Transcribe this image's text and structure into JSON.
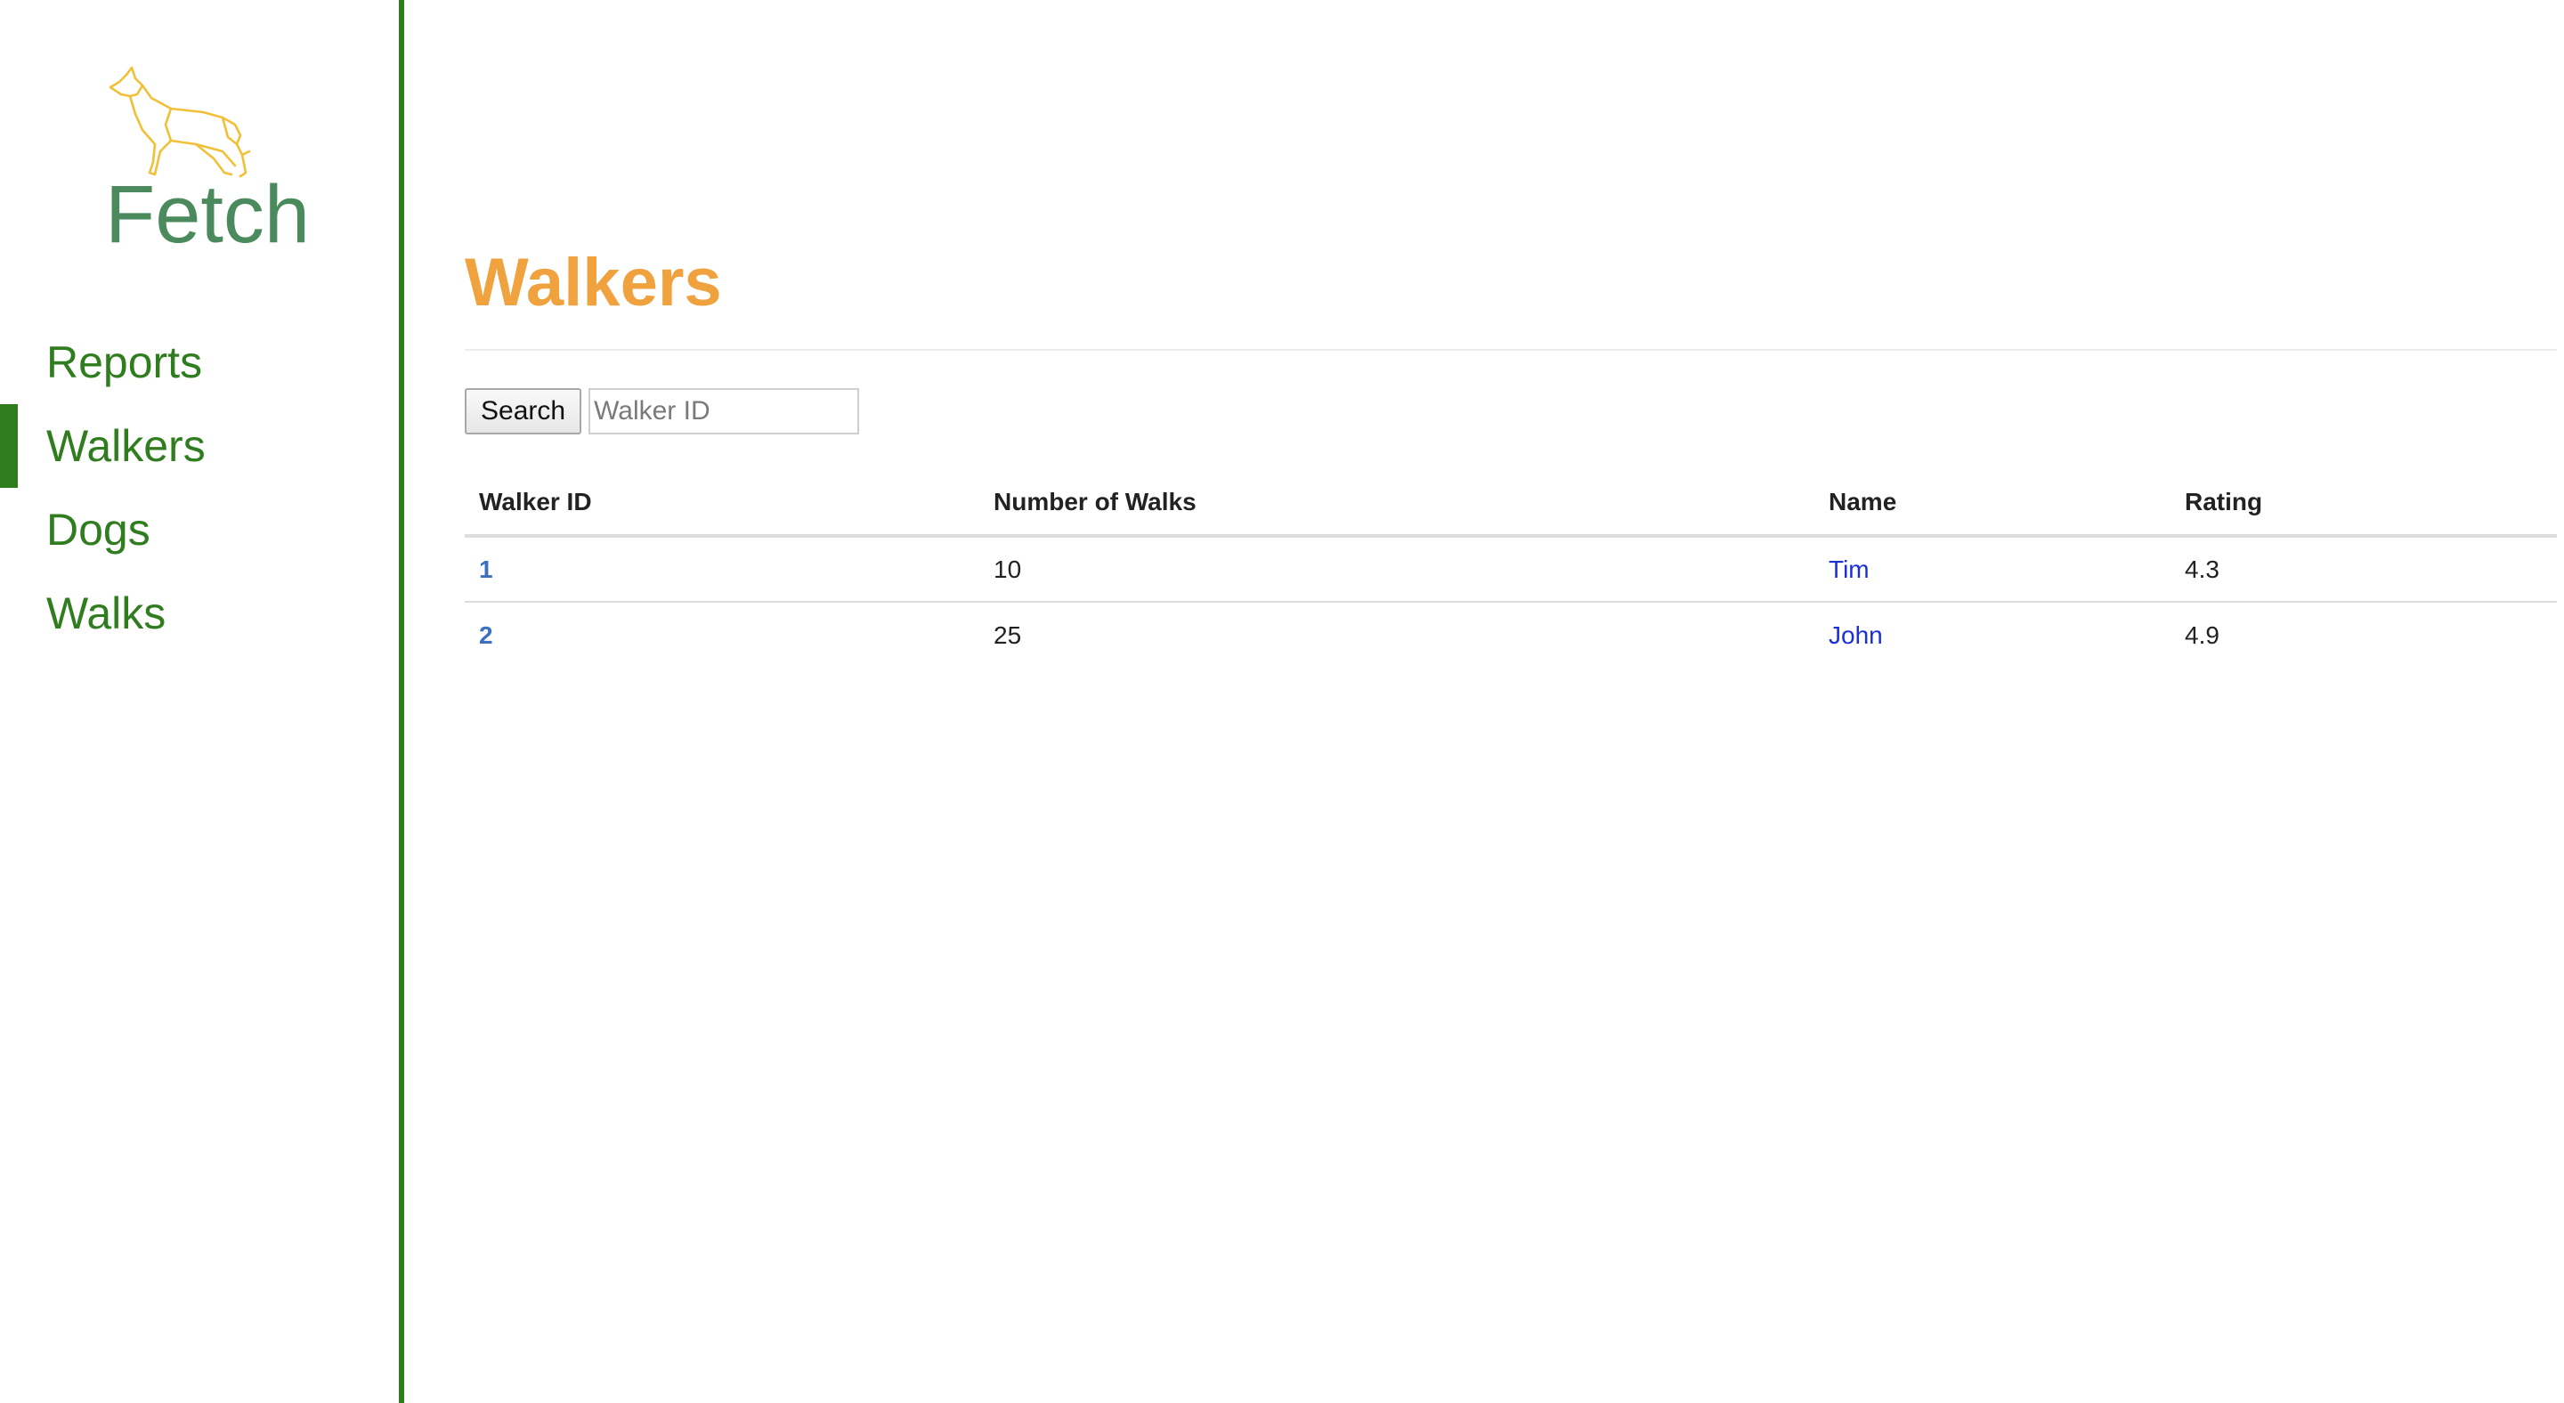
{
  "logo": {
    "text": "Fetch",
    "icon": "dog-icon",
    "text_color": "#4a8a5c",
    "icon_color": "#f2c037"
  },
  "sidebar": {
    "accent_color": "#2f7d1f",
    "items": [
      {
        "label": "Reports",
        "active": false
      },
      {
        "label": "Walkers",
        "active": true
      },
      {
        "label": "Dogs",
        "active": false
      },
      {
        "label": "Walks",
        "active": false
      }
    ]
  },
  "page": {
    "title": "Walkers",
    "title_color": "#f0a23e"
  },
  "search": {
    "button_label": "Search",
    "placeholder": "Walker ID",
    "value": ""
  },
  "table": {
    "headers": [
      "Walker ID",
      "Number of Walks",
      "Name",
      "Rating"
    ],
    "rows": [
      {
        "id": "1",
        "walks": "10",
        "name": "Tim",
        "rating": "4.3"
      },
      {
        "id": "2",
        "walks": "25",
        "name": "John",
        "rating": "4.9"
      }
    ]
  }
}
